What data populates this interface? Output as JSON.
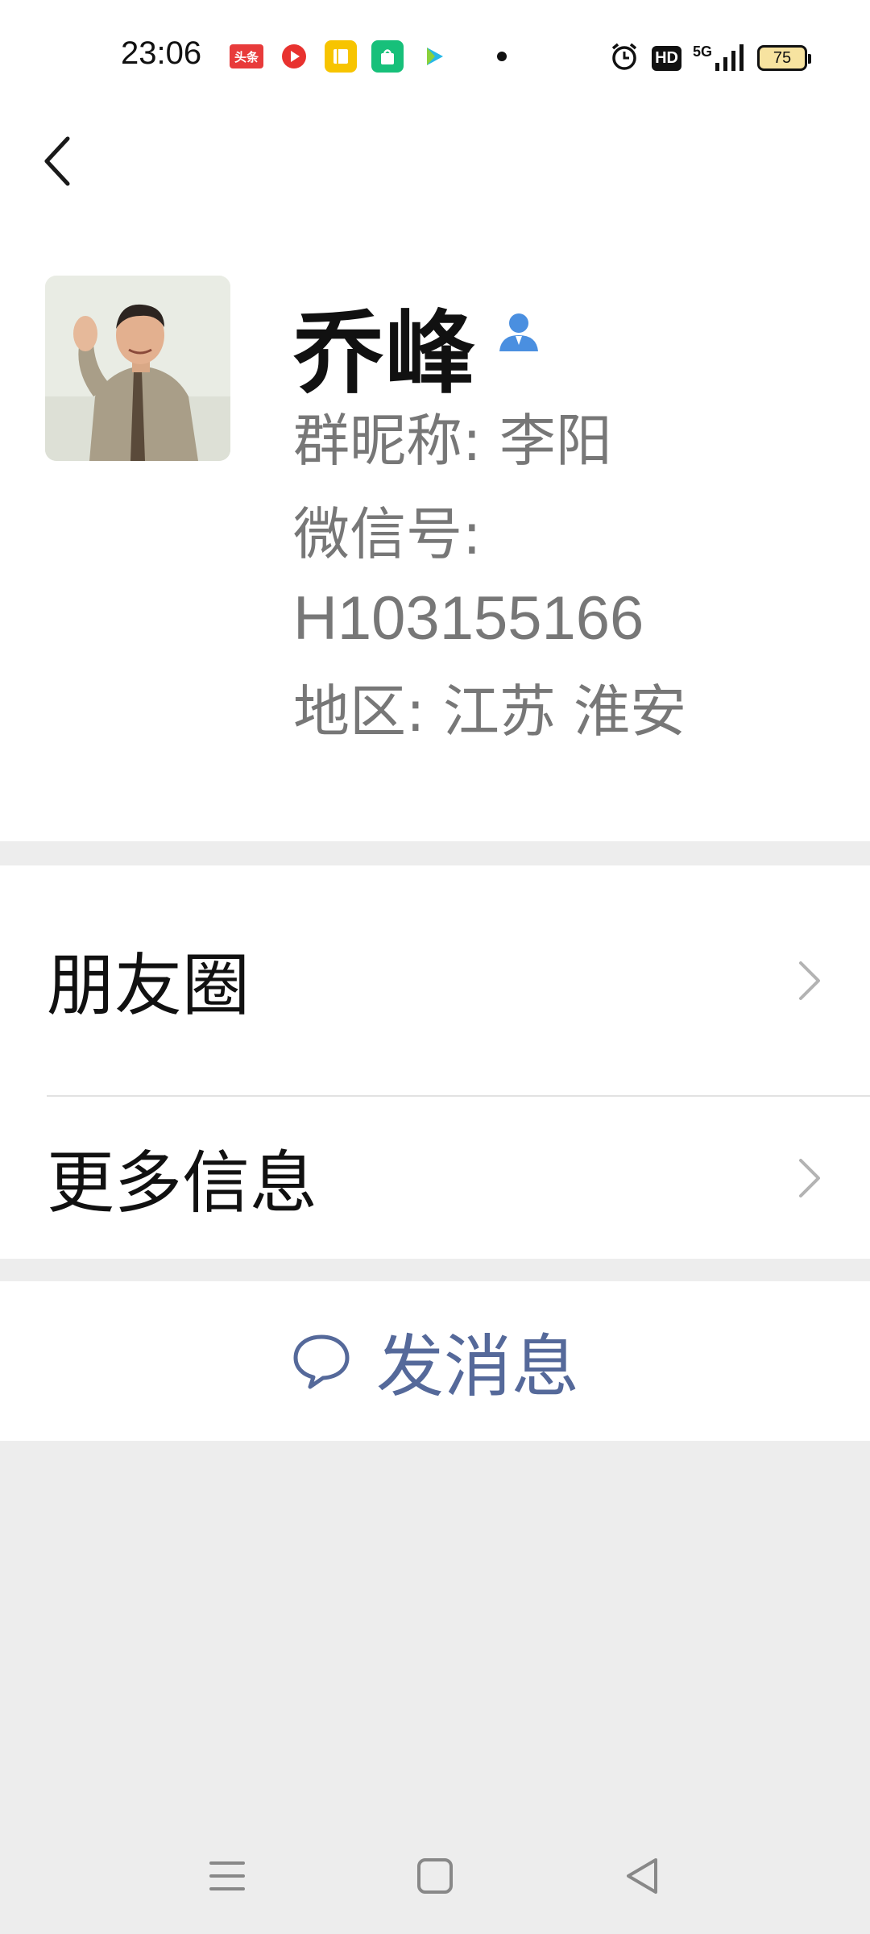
{
  "status_bar": {
    "time": "23:06",
    "notif_icons": [
      "toutiao-icon",
      "red-app-icon",
      "yellow-app-icon",
      "green-app-icon",
      "play-app-icon"
    ],
    "toutiao_label": "头条",
    "network": "5G",
    "hd": "HD",
    "battery": "75"
  },
  "profile": {
    "name": "乔峰",
    "group_nickname": "群昵称:  李阳",
    "wechat_id_label": "微信号:",
    "wechat_id": "H103155166",
    "region": "地区:  江苏  淮安"
  },
  "menu": {
    "items": [
      {
        "label": "朋友圈"
      },
      {
        "label": "更多信息"
      }
    ]
  },
  "actions": {
    "send_message": "发消息"
  },
  "colors": {
    "accent_link": "#55699a",
    "contact_icon": "#4a8fe0",
    "background": "#ededed"
  }
}
